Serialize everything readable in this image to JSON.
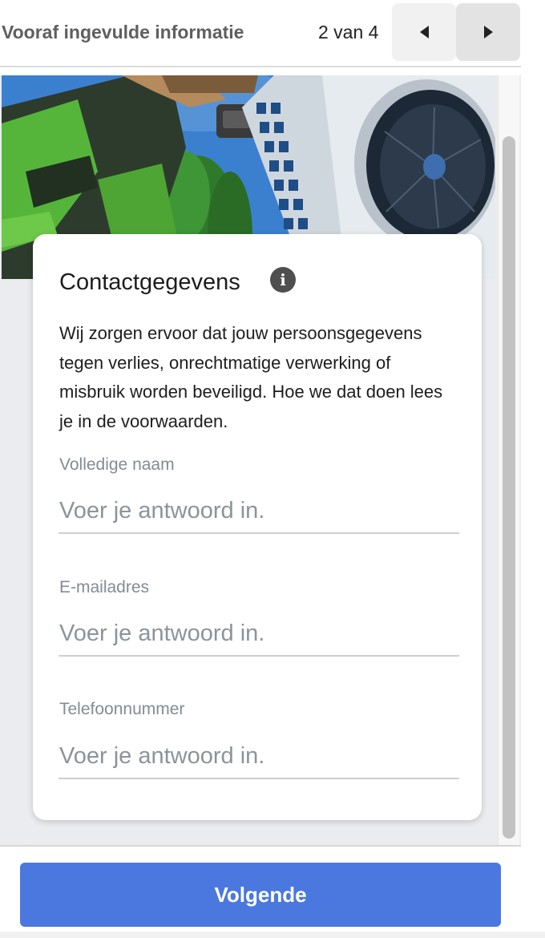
{
  "header": {
    "title": "Vooraf ingevulde informatie",
    "pager": "2 van 4"
  },
  "card": {
    "title": "Contactgegevens",
    "description": "Wij zorgen ervoor dat jouw persoonsgegevens tegen verlies, onrechtmatige verwerking of misbruik worden beveiligd. Hoe we dat doen lees je in de voorwaarden.",
    "fields": [
      {
        "label": "Volledige naam",
        "placeholder": "Voer je antwoord in.",
        "value": ""
      },
      {
        "label": "E-mailadres",
        "placeholder": "Voer je antwoord in.",
        "value": ""
      },
      {
        "label": "Telefoonnummer",
        "placeholder": "Voer je antwoord in.",
        "value": ""
      }
    ]
  },
  "footer": {
    "next_label": "Volgende"
  },
  "icons": {
    "previous": "triangle-left-icon",
    "next": "triangle-right-icon",
    "info": "info-icon"
  },
  "colors": {
    "accent": "#4a78df",
    "page_background": "#ebecef",
    "card_background": "#ffffff"
  }
}
